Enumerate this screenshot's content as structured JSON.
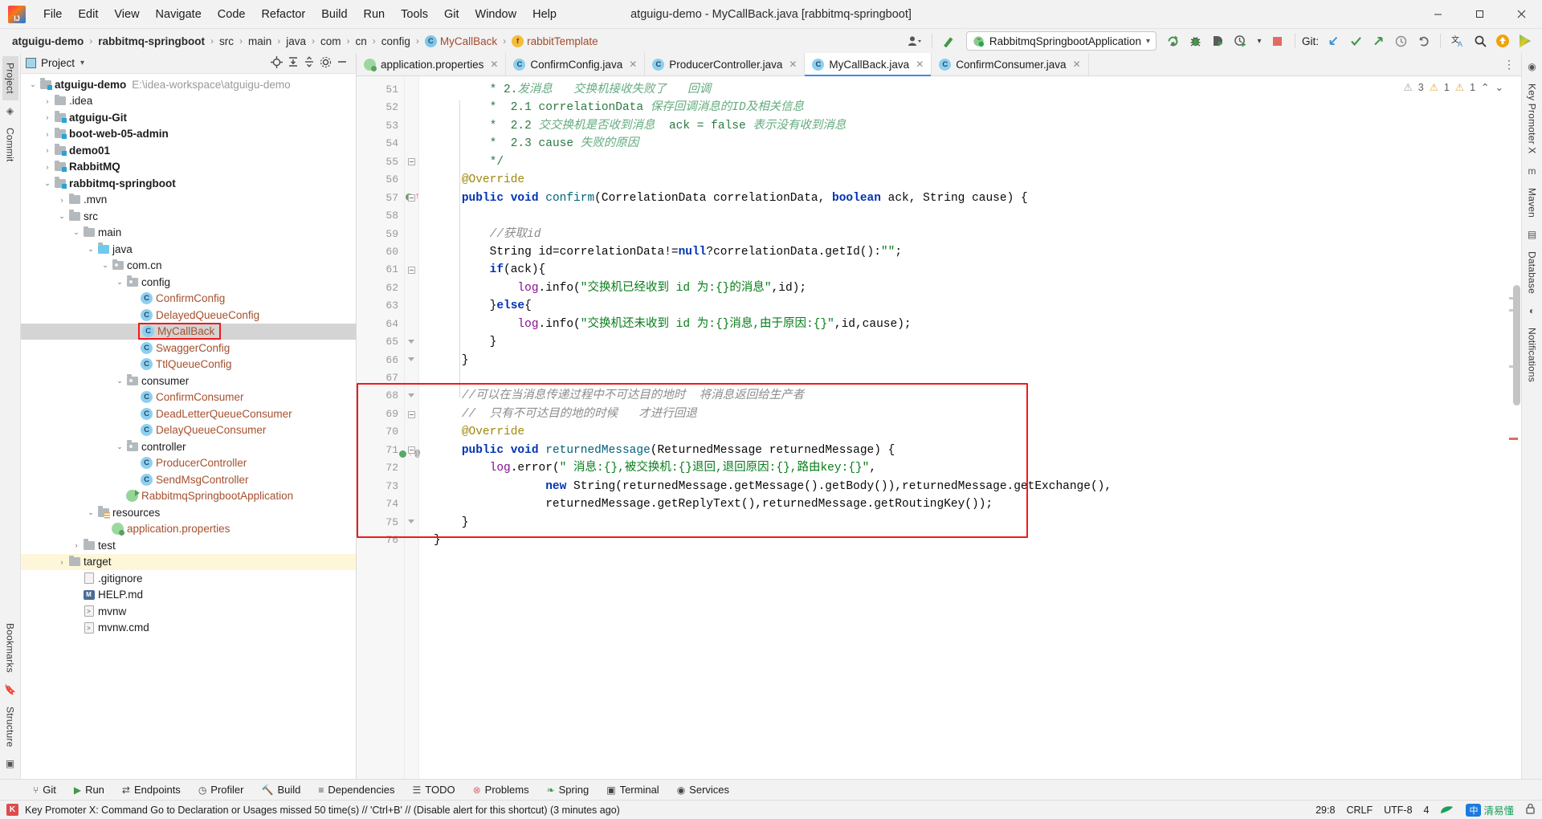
{
  "window": {
    "title": "atguigu-demo - MyCallBack.java [rabbitmq-springboot]",
    "minimize": "–",
    "maximize": "☐",
    "close": "✕"
  },
  "menubar": {
    "items": [
      "File",
      "Edit",
      "View",
      "Navigate",
      "Code",
      "Refactor",
      "Build",
      "Run",
      "Tools",
      "Git",
      "Window",
      "Help"
    ]
  },
  "breadcrumb": {
    "items": [
      {
        "label": "atguigu-demo",
        "style": "bold"
      },
      {
        "label": "rabbitmq-springboot",
        "style": "bold"
      },
      {
        "label": "src",
        "style": "normal"
      },
      {
        "label": "main",
        "style": "normal"
      },
      {
        "label": "java",
        "style": "normal"
      },
      {
        "label": "com",
        "style": "normal"
      },
      {
        "label": "cn",
        "style": "normal"
      },
      {
        "label": "config",
        "style": "normal"
      },
      {
        "label": "MyCallBack",
        "style": "class",
        "badge": "C"
      },
      {
        "label": "rabbitTemplate",
        "style": "field",
        "badge": "f"
      }
    ],
    "separator": "›"
  },
  "toolbar": {
    "run_config": "RabbitmqSpringbootApplication",
    "run_config_caret": "▾",
    "git_label": "Git:",
    "icons": {
      "profile": "user-profile-icon",
      "build_hammer": "build-hammer-icon",
      "rerun": "rerun-icon",
      "debug": "debug-bug-icon",
      "run_with_coverage": "coverage-icon",
      "profiler": "profiler-clock-icon",
      "stop": "stop-icon",
      "update_project": "update-project-icon",
      "commit": "commit-check-icon",
      "push": "push-arrow-icon",
      "history": "history-clock-icon",
      "rollback": "rollback-icon",
      "translate": "translate-icon",
      "search_everywhere": "search-icon",
      "upload": "upload-icon",
      "ide_feature": "play-color-icon"
    }
  },
  "left_rail": {
    "tabs": [
      "Project",
      "Commit"
    ],
    "bottom_tabs": [
      "Bookmarks",
      "Structure"
    ]
  },
  "right_rail": {
    "tabs": [
      "Key Promoter X",
      "Maven",
      "Database",
      "Notifications"
    ]
  },
  "project_panel": {
    "title": "Project",
    "caret": "▾",
    "header_icons": [
      "locate-target-icon",
      "expand-all-icon",
      "collapse-all-icon",
      "settings-gear-icon",
      "hide-minus-icon"
    ],
    "tree": [
      {
        "depth": 0,
        "arrow": "down",
        "icon": "module-folder",
        "label": "atguigu-demo",
        "bold": true,
        "suffix": "E:\\idea-workspace\\atguigu-demo"
      },
      {
        "depth": 1,
        "arrow": "right",
        "icon": "folder",
        "label": ".idea"
      },
      {
        "depth": 1,
        "arrow": "right",
        "icon": "module-folder",
        "label": "atguigu-Git",
        "bold": true
      },
      {
        "depth": 1,
        "arrow": "right",
        "icon": "module-folder",
        "label": "boot-web-05-admin",
        "bold": true
      },
      {
        "depth": 1,
        "arrow": "right",
        "icon": "module-folder",
        "label": "demo01",
        "bold": true
      },
      {
        "depth": 1,
        "arrow": "right",
        "icon": "module-folder",
        "label": "RabbitMQ",
        "bold": true
      },
      {
        "depth": 1,
        "arrow": "down",
        "icon": "module-folder",
        "label": "rabbitmq-springboot",
        "bold": true
      },
      {
        "depth": 2,
        "arrow": "right",
        "icon": "folder",
        "label": ".mvn"
      },
      {
        "depth": 2,
        "arrow": "down",
        "icon": "folder",
        "label": "src"
      },
      {
        "depth": 3,
        "arrow": "down",
        "icon": "folder",
        "label": "main"
      },
      {
        "depth": 4,
        "arrow": "down",
        "icon": "source-folder",
        "label": "java"
      },
      {
        "depth": 5,
        "arrow": "down",
        "icon": "package",
        "label": "com.cn"
      },
      {
        "depth": 6,
        "arrow": "down",
        "icon": "package",
        "label": "config"
      },
      {
        "depth": 7,
        "arrow": "none",
        "icon": "class",
        "label": "ConfirmConfig",
        "cls": true
      },
      {
        "depth": 7,
        "arrow": "none",
        "icon": "class",
        "label": "DelayedQueueConfig",
        "cls": true
      },
      {
        "depth": 7,
        "arrow": "none",
        "icon": "class",
        "label": "MyCallBack",
        "cls": true,
        "selected": true,
        "highlight_box": true
      },
      {
        "depth": 7,
        "arrow": "none",
        "icon": "class",
        "label": "SwaggerConfig",
        "cls": true
      },
      {
        "depth": 7,
        "arrow": "none",
        "icon": "class",
        "label": "TtlQueueConfig",
        "cls": true
      },
      {
        "depth": 6,
        "arrow": "down",
        "icon": "package",
        "label": "consumer"
      },
      {
        "depth": 7,
        "arrow": "none",
        "icon": "class",
        "label": "ConfirmConsumer",
        "cls": true
      },
      {
        "depth": 7,
        "arrow": "none",
        "icon": "class",
        "label": "DeadLetterQueueConsumer",
        "cls": true
      },
      {
        "depth": 7,
        "arrow": "none",
        "icon": "class",
        "label": "DelayQueueConsumer",
        "cls": true
      },
      {
        "depth": 6,
        "arrow": "down",
        "icon": "package",
        "label": "controller"
      },
      {
        "depth": 7,
        "arrow": "none",
        "icon": "class",
        "label": "ProducerController",
        "cls": true
      },
      {
        "depth": 7,
        "arrow": "none",
        "icon": "class",
        "label": "SendMsgController",
        "cls": true
      },
      {
        "depth": 6,
        "arrow": "none",
        "icon": "spring-class",
        "label": "RabbitmqSpringbootApplication",
        "cls": true
      },
      {
        "depth": 4,
        "arrow": "down",
        "icon": "resources-folder",
        "label": "resources"
      },
      {
        "depth": 5,
        "arrow": "none",
        "icon": "properties",
        "label": "application.properties",
        "cls": true
      },
      {
        "depth": 3,
        "arrow": "right",
        "icon": "folder",
        "label": "test"
      },
      {
        "depth": 2,
        "arrow": "right",
        "icon": "folder",
        "label": "target",
        "target_hl": true
      },
      {
        "depth": 3,
        "arrow": "none",
        "icon": "file",
        "label": ".gitignore"
      },
      {
        "depth": 3,
        "arrow": "none",
        "icon": "md",
        "label": "HELP.md"
      },
      {
        "depth": 3,
        "arrow": "none",
        "icon": "sh",
        "label": "mvnw"
      },
      {
        "depth": 3,
        "arrow": "none",
        "icon": "sh",
        "label": "mvnw.cmd"
      }
    ]
  },
  "editor": {
    "tabs": [
      {
        "label": "application.properties",
        "icon": "properties-icon",
        "active": false
      },
      {
        "label": "ConfirmConfig.java",
        "icon": "class-icon",
        "active": false
      },
      {
        "label": "ProducerController.java",
        "icon": "class-icon",
        "active": false
      },
      {
        "label": "MyCallBack.java",
        "icon": "class-icon",
        "active": true
      },
      {
        "label": "ConfirmConsumer.java",
        "icon": "class-icon",
        "active": false
      }
    ],
    "tab_close": "✕",
    "more_tabs": "⋮",
    "inspections": {
      "errors": "3",
      "warnings": "1",
      "weak_warnings": "1",
      "up": "⌃",
      "down": "⌄",
      "error_icon": "error-triangle-icon",
      "warning_icon": "warning-triangle-icon"
    },
    "first_line_number": 51,
    "lines": [
      {
        "n": 51,
        "html": "        <span class='doc'>* 2.</span><span class='doc-i'>发消息   交换机接收失败了   回调</span>"
      },
      {
        "n": 52,
        "html": "        <span class='doc'>*  2.1 correlationData</span><span class='doc-i'> 保存回调消息的ID及相关信息</span>"
      },
      {
        "n": 53,
        "html": "        <span class='doc'>*  2.2 </span><span class='doc-i'>交交换机是否收到消息  </span><span class='doc'>ack = false</span><span class='doc-i'> 表示没有收到消息</span>"
      },
      {
        "n": 54,
        "html": "        <span class='doc'>*  2.3 cause</span><span class='doc-i'> 失败的原因</span>"
      },
      {
        "n": 55,
        "html": "        <span class='doc'>*/</span>",
        "fold": "minus"
      },
      {
        "n": 56,
        "html": "    <span class='ann'>@Override</span>"
      },
      {
        "n": 57,
        "html": "    <span class='kw'>public</span> <span class='kw'>void</span> <span class='mth'>confirm</span>(CorrelationData correlationData, <span class='kw'>boolean</span> ack, String cause) {",
        "gmark": "run-breakpoint",
        "fold": "minus"
      },
      {
        "n": 58,
        "html": ""
      },
      {
        "n": 59,
        "html": "        <span class='cmt'>//获取id</span>"
      },
      {
        "n": 60,
        "html": "        String id=correlationData!=<span class='kw'>null</span>?correlationData.getId():<span class='str'>\"\"</span>;"
      },
      {
        "n": 61,
        "html": "        <span class='kw'>if</span>(ack){",
        "fold": "minus"
      },
      {
        "n": 62,
        "html": "            <span class='fld'>log</span>.info(<span class='str'>\"交换机已经收到 id 为:{}的消息\"</span>,id);"
      },
      {
        "n": 63,
        "html": "        }<span class='kw'>else</span>{"
      },
      {
        "n": 64,
        "html": "            <span class='fld'>log</span>.info(<span class='str'>\"交换机还未收到 id 为:{}消息,由于原因:{}\"</span>,id,cause);"
      },
      {
        "n": 65,
        "html": "        }",
        "fold": "tri"
      },
      {
        "n": 66,
        "html": "    }",
        "fold": "tri"
      },
      {
        "n": 67,
        "html": ""
      },
      {
        "n": 68,
        "html": "    <span class='cmt'>//可以在当消息传递过程中不可达目的地时  将消息返回给生产者</span>",
        "fold": "tri"
      },
      {
        "n": 69,
        "html": "    <span class='cmt'>//  只有不可达目的地的时候   才进行回退</span>",
        "fold": "minus"
      },
      {
        "n": 70,
        "html": "    <span class='ann'>@Override</span>"
      },
      {
        "n": 71,
        "html": "    <span class='kw'>public</span> <span class='kw'>void</span> <span class='mth'>returnedMessage</span>(ReturnedMessage returnedMessage) {",
        "gmark": "run-breakpoint-at",
        "fold": "minus"
      },
      {
        "n": 72,
        "html": "        <span class='fld'>log</span>.error(<span class='str'>\" 消息:{},被交换机:{}退回,退回原因:{},路由key:{}\"</span>,"
      },
      {
        "n": 73,
        "html": "                <span class='kw'>new</span> String(returnedMessage.getMessage().getBody()),returnedMessage.getExchange(),"
      },
      {
        "n": 74,
        "html": "                returnedMessage.getReplyText(),returnedMessage.getRoutingKey());"
      },
      {
        "n": 75,
        "html": "    }",
        "fold": "tri"
      },
      {
        "n": 76,
        "html": "}"
      }
    ]
  },
  "bottom_bar": {
    "items": [
      {
        "label": "Git",
        "icon": "git-branch-icon"
      },
      {
        "label": "Run",
        "icon": "run-play-icon"
      },
      {
        "label": "Endpoints",
        "icon": "endpoints-icon"
      },
      {
        "label": "Profiler",
        "icon": "profiler-icon"
      },
      {
        "label": "Build",
        "icon": "build-hammer-icon"
      },
      {
        "label": "Dependencies",
        "icon": "dependencies-icon"
      },
      {
        "label": "TODO",
        "icon": "todo-list-icon"
      },
      {
        "label": "Problems",
        "icon": "problems-icon"
      },
      {
        "label": "Spring",
        "icon": "spring-leaf-icon"
      },
      {
        "label": "Terminal",
        "icon": "terminal-icon"
      },
      {
        "label": "Services",
        "icon": "services-icon"
      }
    ]
  },
  "status_bar": {
    "message": "Key Promoter X: Command Go to Declaration or Usages missed 50 time(s) // 'Ctrl+B' // (Disable alert for this shortcut) (3 minutes ago)",
    "caret": "29:8",
    "line_separator": "CRLF",
    "encoding": "UTF-8",
    "indent": "4",
    "ime": [
      "中",
      "清易懂"
    ],
    "lock_icon": "lock-icon"
  }
}
